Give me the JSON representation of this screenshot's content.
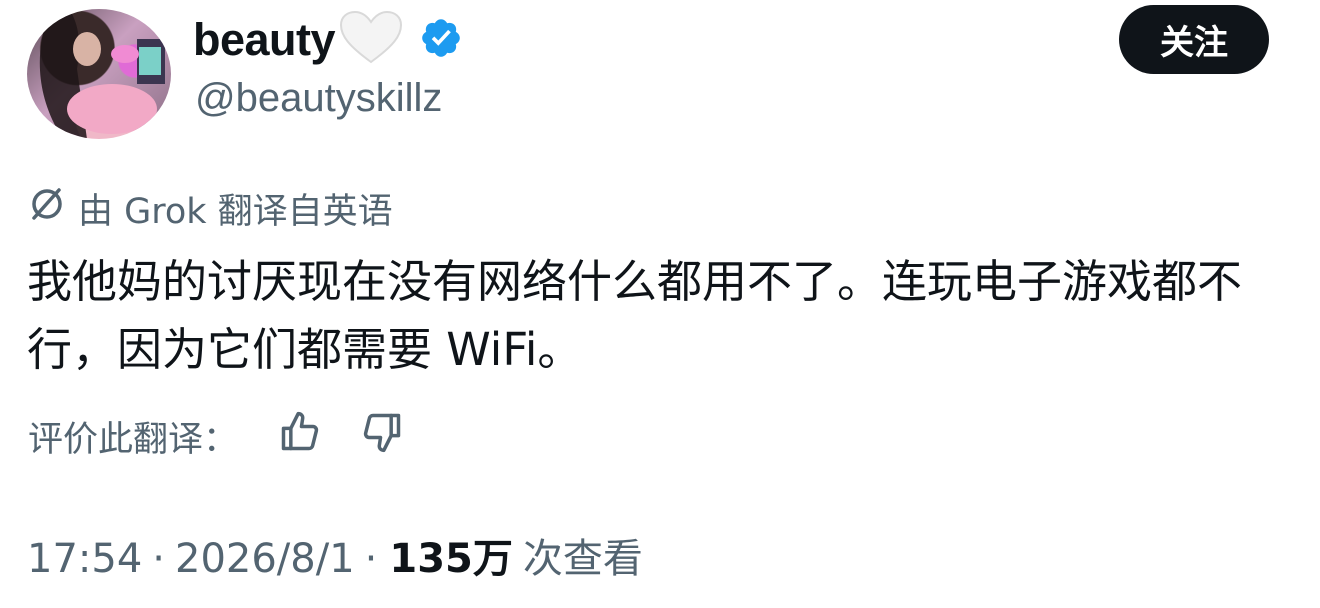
{
  "author": {
    "display_name": "beauty",
    "handle": "@beautyskillz",
    "verified": true,
    "emoji": "white-heart"
  },
  "follow_button": {
    "label": "关注"
  },
  "translation": {
    "notice": "由 Grok 翻译自英语",
    "rate_label": "评价此翻译："
  },
  "tweet": {
    "text": "我他妈的讨厌现在没有网络什么都用不了。连玩电子游戏都不行，因为它们都需要 WiFi。"
  },
  "meta": {
    "time": "17:54",
    "separator": "·",
    "date": "2026/8/1",
    "views_count": "135万",
    "views_label": "次查看"
  },
  "icons": {
    "grok": "grok-icon",
    "thumbs_up": "thumbs-up-icon",
    "thumbs_down": "thumbs-down-icon",
    "verified": "verified-badge-icon",
    "heart": "white-heart-icon"
  },
  "colors": {
    "verified_blue": "#1d9bf0",
    "secondary_text": "#536471",
    "primary_text": "#0f1419",
    "button_bg": "#0f1419"
  }
}
